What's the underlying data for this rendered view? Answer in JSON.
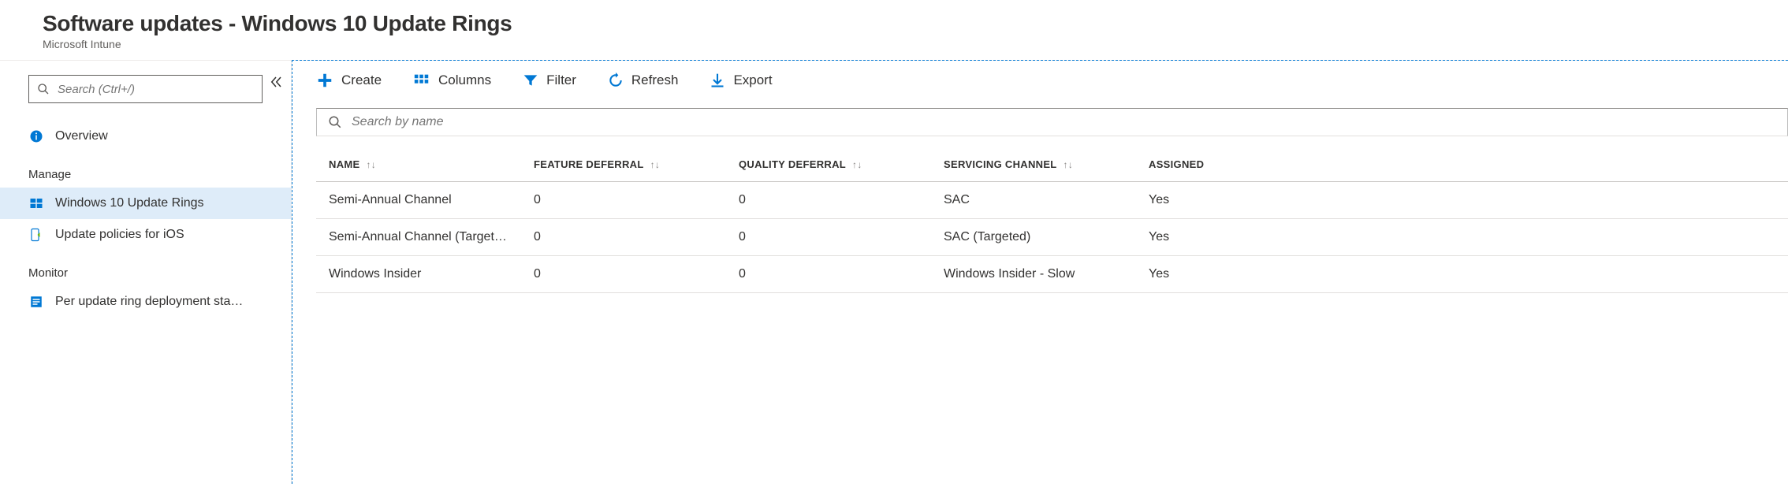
{
  "header": {
    "title": "Software updates - Windows 10 Update Rings",
    "subtitle": "Microsoft Intune"
  },
  "sidebar": {
    "search_placeholder": "Search (Ctrl+/)",
    "overview_label": "Overview",
    "sections": {
      "manage": {
        "title": "Manage",
        "items": [
          {
            "label": "Windows 10 Update Rings",
            "selected": true
          },
          {
            "label": "Update policies for iOS",
            "selected": false
          }
        ]
      },
      "monitor": {
        "title": "Monitor",
        "items": [
          {
            "label": "Per update ring deployment sta…",
            "selected": false
          }
        ]
      }
    }
  },
  "toolbar": {
    "create": "Create",
    "columns": "Columns",
    "filter": "Filter",
    "refresh": "Refresh",
    "export": "Export"
  },
  "main_search_placeholder": "Search by name",
  "table": {
    "headers": {
      "name": "NAME",
      "feature_deferral": "FEATURE DEFERRAL",
      "quality_deferral": "QUALITY DEFERRAL",
      "servicing_channel": "SERVICING CHANNEL",
      "assigned": "ASSIGNED"
    },
    "rows": [
      {
        "name": "Semi-Annual Channel",
        "fd": "0",
        "qd": "0",
        "sc": "SAC",
        "assigned": "Yes"
      },
      {
        "name": "Semi-Annual Channel (Targeted)",
        "fd": "0",
        "qd": "0",
        "sc": "SAC (Targeted)",
        "assigned": "Yes"
      },
      {
        "name": "Windows Insider",
        "fd": "0",
        "qd": "0",
        "sc": "Windows Insider - Slow",
        "assigned": "Yes"
      }
    ]
  }
}
